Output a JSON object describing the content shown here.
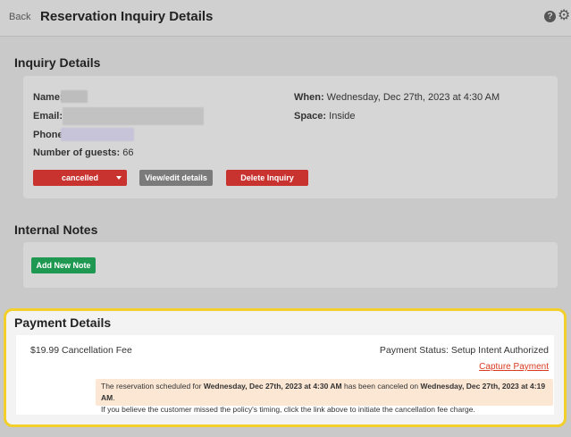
{
  "header": {
    "back_label": "Back",
    "title": "Reservation Inquiry Details",
    "help_icon": "help-circle-icon",
    "settings_icon": "gear-icon"
  },
  "inquiry": {
    "heading": "Inquiry Details",
    "name_label": "Name:",
    "email_label": "Email:",
    "phone_label": "Phone:",
    "guests_label": "Number of guests:",
    "guests_value": "66",
    "when_label": "When:",
    "when_value": "Wednesday, Dec 27th, 2023 at 4:30 AM",
    "space_label": "Space:",
    "space_value": "Inside",
    "status_button": "cancelled",
    "view_edit_button": "View/edit details",
    "delete_button": "Delete Inquiry"
  },
  "notes": {
    "heading": "Internal Notes",
    "add_button": "Add New Note"
  },
  "payment": {
    "heading": "Payment Details",
    "fee_label": "$19.99 Cancellation Fee",
    "status_label": "Payment Status: Setup Intent Authorized",
    "capture_link": "Capture Payment",
    "notice_part1": "The reservation scheduled for ",
    "notice_bold1": "Wednesday, Dec 27th, 2023 at 4:30 AM",
    "notice_part2": " has been canceled on ",
    "notice_bold2": "Wednesday, Dec 27th, 2023 at 4:19 AM",
    "notice_part3": ".",
    "notice_line2": "If you believe the customer missed the policy's timing, click the link above to initiate the cancellation fee charge."
  },
  "colors": {
    "highlight_border": "#f2cf2a",
    "danger": "#c8322f",
    "success": "#1f9952",
    "notice_bg": "#fbe7d4",
    "link": "#d9391f"
  }
}
